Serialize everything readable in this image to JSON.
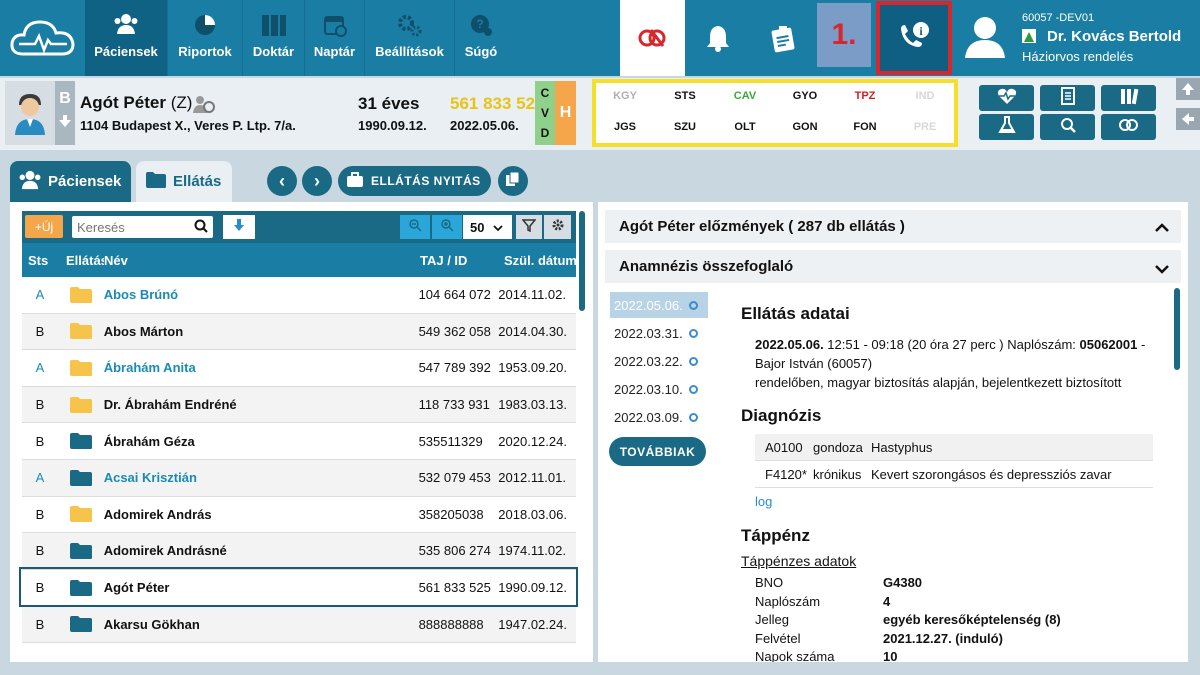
{
  "nav": {
    "items": [
      {
        "label": "Páciensek",
        "icon": "patients-icon"
      },
      {
        "label": "Riportok",
        "icon": "pie-chart-icon"
      },
      {
        "label": "Doktár",
        "icon": "archive-icon"
      },
      {
        "label": "Naptár",
        "icon": "calendar-icon"
      },
      {
        "label": "Beállítások",
        "icon": "gears-icon"
      },
      {
        "label": "Súgó",
        "icon": "help-icon"
      }
    ],
    "step_badge": "1.",
    "user": {
      "code": "60057 -DEV01",
      "name": "Dr. Kovács Bertold",
      "role": "Háziorvos rendelés"
    }
  },
  "patient": {
    "category": "B",
    "name": "Agót Péter",
    "suffix": "(Z)",
    "address": "1104 Budapest X., Veres P. Ltp. 7/a.",
    "age": "31 éves",
    "birth": "1990.09.12.",
    "taj": "561 833 52",
    "date": "2022.05.06.",
    "cvd": [
      "C",
      "V",
      "D"
    ],
    "h": "H"
  },
  "flags": {
    "row1": [
      {
        "label": "KGY",
        "color": "#b0b0b0"
      },
      {
        "label": "STS",
        "color": "#111111"
      },
      {
        "label": "CAV",
        "color": "#3aa83a"
      },
      {
        "label": "GYO",
        "color": "#111111"
      },
      {
        "label": "TPZ",
        "color": "#d62020"
      },
      {
        "label": "IND",
        "color": "#d8d8d8"
      }
    ],
    "row2": [
      {
        "label": "JGS",
        "color": "#111111"
      },
      {
        "label": "SZU",
        "color": "#111111"
      },
      {
        "label": "OLT",
        "color": "#111111"
      },
      {
        "label": "GON",
        "color": "#111111"
      },
      {
        "label": "FON",
        "color": "#111111"
      },
      {
        "label": "PRE",
        "color": "#d8d8d8"
      }
    ]
  },
  "tabs": {
    "patients": "Páciensek",
    "care": "Ellátás",
    "open_care": "ELLÁTÁS NYITÁS"
  },
  "list": {
    "new_label": "+Új",
    "search_placeholder": "Keresés",
    "page_size": "50",
    "headers": {
      "sts": "Sts",
      "care": "Ellátás",
      "name": "Név",
      "taj": "TAJ / ID",
      "birth": "Szül. dátum"
    },
    "rows": [
      {
        "sts": "A",
        "folder": "yellow",
        "name": "Abos Brúnó",
        "taj": "104 664 072",
        "birth": "2014.11.02."
      },
      {
        "sts": "B",
        "folder": "yellow",
        "name": "Abos Márton",
        "taj": "549 362 058",
        "birth": "2014.04.30."
      },
      {
        "sts": "A",
        "folder": "yellow",
        "name": "Ábrahám Anita",
        "taj": "547 789 392",
        "birth": "1953.09.20."
      },
      {
        "sts": "B",
        "folder": "yellow",
        "name": "Dr. Ábrahám Endréné",
        "taj": "118 733 931",
        "birth": "1983.03.13."
      },
      {
        "sts": "B",
        "folder": "blue",
        "name": "Ábrahám Géza",
        "taj": "535511329",
        "birth": "2020.12.24."
      },
      {
        "sts": "A",
        "folder": "blue",
        "name": "Acsai Krisztián",
        "taj": "532 079 453",
        "birth": "2012.11.01."
      },
      {
        "sts": "B",
        "folder": "yellow",
        "name": "Adomirek András",
        "taj": "358205038",
        "birth": "2018.03.06."
      },
      {
        "sts": "B",
        "folder": "blue",
        "name": "Adomirek Andrásné",
        "taj": "535 806 274",
        "birth": "1974.11.02."
      },
      {
        "sts": "B",
        "folder": "blue",
        "name": "Agót Péter",
        "taj": "561 833 525",
        "birth": "1990.09.12."
      },
      {
        "sts": "B",
        "folder": "blue",
        "name": "Akarsu Gökhan",
        "taj": "888888888",
        "birth": "1947.02.24."
      }
    ]
  },
  "history": {
    "title": "Agót Péter előzmények ( 287 db ellátás )",
    "anamnesis": "Anamnézis összefoglaló",
    "dates": [
      "2022.05.06.",
      "2022.03.31.",
      "2022.03.22.",
      "2022.03.10.",
      "2022.03.09."
    ],
    "more": "TOVÁBBIAK",
    "care_title": "Ellátás adatai",
    "care_date": "2022.05.06.",
    "care_line1": " 12:51 - 09:18 (20 óra 27 perc ) Naplószám: ",
    "care_log": "05062001",
    "care_line1_end": " -",
    "care_line2": "Bajor István (60057)",
    "care_line3": "rendelőben, magyar biztosítás alapján, bejelentkezett biztosított",
    "diag_title": "Diagnózis",
    "diagnoses": [
      {
        "code": "A0100",
        "type": "gondoza",
        "desc": "Hastyphus"
      },
      {
        "code": "F4120*",
        "type": "krónikus",
        "desc": "Kevert szorongásos és depressziós zavar"
      }
    ],
    "log_link": "log",
    "sick_title": "Táppénz",
    "sick_link": "Táppénzes adatok",
    "sick_rows": [
      {
        "k": "BNO",
        "v": "G4380"
      },
      {
        "k": "Naplószám",
        "v": "4"
      },
      {
        "k": "Jelleg",
        "v": "egyéb keresőképtelenség (8)"
      },
      {
        "k": "Felvétel",
        "v": "2021.12.27. (induló)"
      },
      {
        "k": "Napok száma",
        "v": "10"
      }
    ]
  }
}
